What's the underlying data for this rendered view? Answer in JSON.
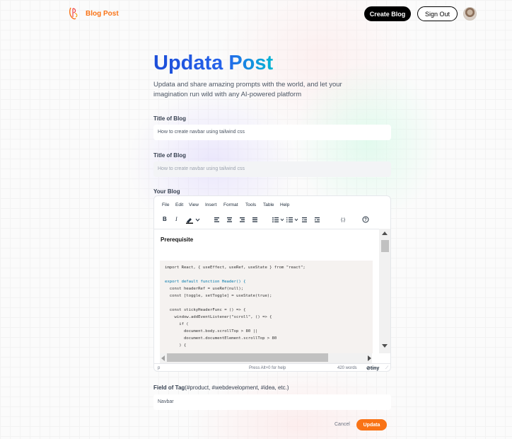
{
  "nav": {
    "brand": "Blog Post",
    "create_label": "Create Blog",
    "signout_label": "Sign Out"
  },
  "header": {
    "title": "Updata Post",
    "description": "Updata and share amazing prompts with the world, and let your imagination run wild with any AI-powered platform"
  },
  "form": {
    "title_label": "Title of Blog",
    "title_value": "How to create navbar using tailwind css",
    "title2_label": "Title of Blog",
    "title2_placeholder": "How to create navbar using tailwind css",
    "blog_label": "Your Blog",
    "tag_label": "Field of Tag",
    "tag_hint": "(#product, #webdevelopment, #idea, etc.)",
    "tag_value": "Navbar"
  },
  "editor": {
    "menu": [
      "File",
      "Edit",
      "View",
      "Insert",
      "Format",
      "Tools",
      "Table",
      "Help"
    ],
    "heading": "Prerequisite",
    "code_lines": [
      "import React, { useEffect, useRef, useState } from \"react\";",
      "",
      "export default function Header() {",
      "  const headerRef = useRef(null);",
      "  const [toggle, setToggle] = useState(true);",
      "",
      "  const stickyHeaderFunc = () => {",
      "    window.addEventListener(\"scroll\", () => {",
      "      if (",
      "        document.body.scrollTop > 80 ||",
      "        document.documentElement.scrollTop > 80",
      "      ) {"
    ],
    "status_path": "p",
    "status_help": "Press Alt+0 for help",
    "status_words": "420 words",
    "brand": "tiny"
  },
  "actions": {
    "cancel_label": "Cancel",
    "update_label": "Updata"
  },
  "colors": {
    "accent": "#f97316",
    "title_gradient_start": "#1d4ed8",
    "title_gradient_end": "#06b6d4"
  }
}
